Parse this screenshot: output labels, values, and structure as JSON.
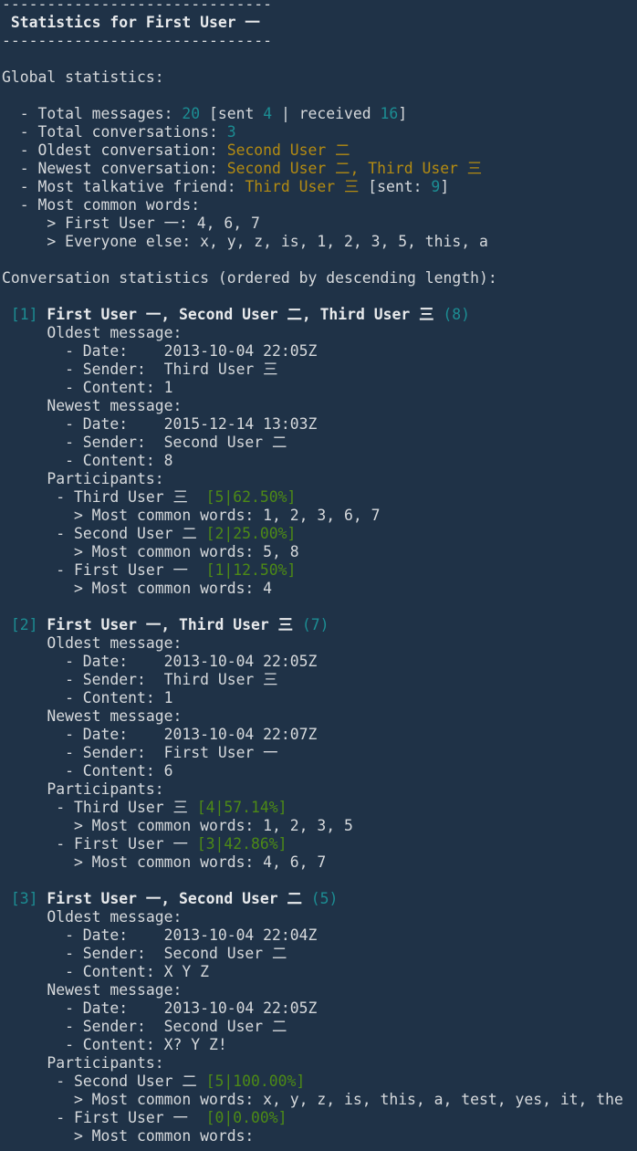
{
  "colors": {
    "background": "#1f3247",
    "text": "#d6d9dc",
    "number": "#1c8d93",
    "user_highlight": "#b38b12",
    "share": "#4d8a16"
  },
  "header": {
    "rule": "------------------------------",
    "title": " Statistics for First User 一"
  },
  "global": {
    "heading": "Global statistics:",
    "total_messages_label": "  - Total messages: ",
    "total_messages": "20",
    "sent_prefix": " [sent ",
    "sent": "4",
    "received_prefix": " | received ",
    "received": "16",
    "close_bracket": "]",
    "total_conversations_label": "  - Total conversations: ",
    "total_conversations": "3",
    "oldest_conversation_label": "  - Oldest conversation: ",
    "oldest_conversation": "Second User 二",
    "newest_conversation_label": "  - Newest conversation: ",
    "newest_conversation": "Second User 二, Third User 三",
    "most_talkative_label": "  - Most talkative friend: ",
    "most_talkative": "Third User 三",
    "most_talkative_sent_prefix": " [sent: ",
    "most_talkative_sent": "9",
    "common_words_label": "  - Most common words:",
    "common_words_self": "     > First User 一: 4, 6, 7",
    "common_words_others": "     > Everyone else: x, y, z, is, 1, 2, 3, 5, this, a"
  },
  "conversations_heading": "Conversation statistics (ordered by descending length):",
  "labels": {
    "oldest": "     Oldest message:",
    "newest": "     Newest message:",
    "date": "       - Date:    ",
    "sender": "       - Sender:  ",
    "content": "       - Content: ",
    "participants": "     Participants:",
    "participant_prefix": "      - ",
    "words_prefix": "        > Most common words: "
  },
  "conversations": [
    {
      "index": " [1]",
      "title": " First User 一, Second User 二, Third User 三",
      "count": " (8)",
      "oldest": {
        "date": "2013-10-04 22:05Z",
        "sender": "Third User 三",
        "content": "1"
      },
      "newest": {
        "date": "2015-12-14 13:03Z",
        "sender": "Second User 二",
        "content": "8"
      },
      "participants": [
        {
          "name": "Third User 三  ",
          "share": "[5|62.50%]",
          "words": "1, 2, 3, 6, 7"
        },
        {
          "name": "Second User 二 ",
          "share": "[2|25.00%]",
          "words": "5, 8"
        },
        {
          "name": "First User 一  ",
          "share": "[1|12.50%]",
          "words": "4"
        }
      ]
    },
    {
      "index": " [2]",
      "title": " First User 一, Third User 三",
      "count": " (7)",
      "oldest": {
        "date": "2013-10-04 22:05Z",
        "sender": "Third User 三",
        "content": "1"
      },
      "newest": {
        "date": "2013-10-04 22:07Z",
        "sender": "First User 一",
        "content": "6"
      },
      "participants": [
        {
          "name": "Third User 三 ",
          "share": "[4|57.14%]",
          "words": "1, 2, 3, 5"
        },
        {
          "name": "First User 一 ",
          "share": "[3|42.86%]",
          "words": "4, 6, 7"
        }
      ]
    },
    {
      "index": " [3]",
      "title": " First User 一, Second User 二",
      "count": " (5)",
      "oldest": {
        "date": "2013-10-04 22:04Z",
        "sender": "Second User 二",
        "content": "X Y Z"
      },
      "newest": {
        "date": "2013-10-04 22:05Z",
        "sender": "Second User 二",
        "content": "X? Y Z!"
      },
      "participants": [
        {
          "name": "Second User 二 ",
          "share": "[5|100.00%]",
          "words": "x, y, z, is, this, a, test, yes, it, the"
        },
        {
          "name": "First User 一  ",
          "share": "[0|0.00%]",
          "words": ""
        }
      ]
    }
  ]
}
